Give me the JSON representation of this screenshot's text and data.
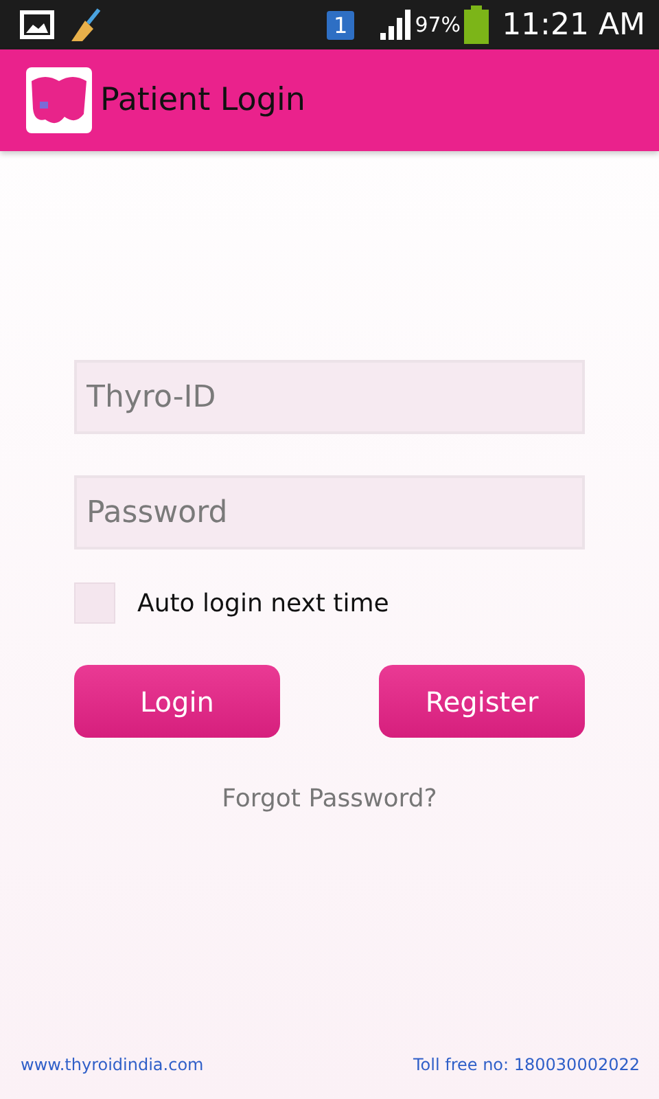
{
  "status_bar": {
    "notification_badge": "1",
    "battery": "97%",
    "time": "11:21 AM"
  },
  "app_bar": {
    "title": "Patient Login"
  },
  "form": {
    "id_field": {
      "placeholder": "Thyro-ID"
    },
    "password_field": {
      "placeholder": "Password"
    },
    "auto_login": {
      "label": "Auto login next time",
      "checked": false
    },
    "buttons": [
      "Login",
      "Register"
    ],
    "forgot_link": "Forgot Password?"
  },
  "footer": {
    "website": "www.thyroidindia.com",
    "toll_free": "Toll free no: 180030002022"
  }
}
